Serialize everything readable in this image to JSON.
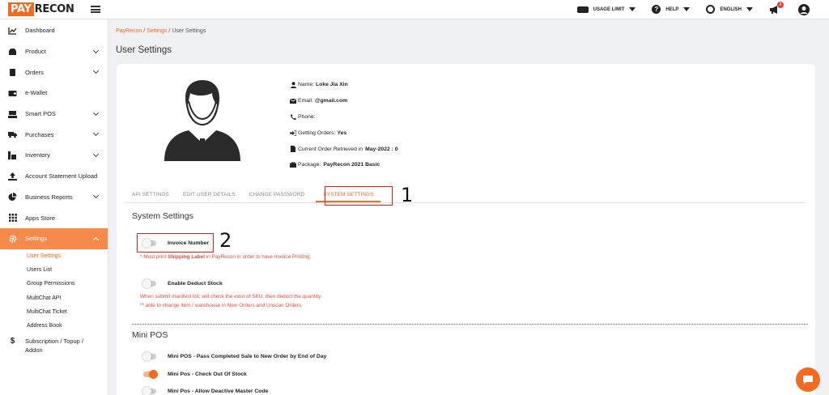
{
  "brand": {
    "pay": "PAY",
    "recon": "RECON",
    "accent": "#f26b21"
  },
  "topbar": {
    "usage_limit": "USAGE LIMIT",
    "help": "HELP",
    "language": "ENGLISH",
    "notification_count": "2"
  },
  "sidebar": {
    "items": [
      {
        "label": "Dashboard",
        "icon": "chart-line-icon"
      },
      {
        "label": "Product",
        "icon": "box-icon"
      },
      {
        "label": "Orders",
        "icon": "clipboard-icon"
      },
      {
        "label": "e-Wallet",
        "icon": "wallet-icon"
      },
      {
        "label": "Smart POS",
        "icon": "pos-icon"
      },
      {
        "label": "Purchases",
        "icon": "truck-icon"
      },
      {
        "label": "Inventory",
        "icon": "boxes-icon"
      },
      {
        "label": "Account Statement Upload",
        "icon": "upload-icon"
      },
      {
        "label": "Business Reports",
        "icon": "pie-chart-icon"
      },
      {
        "label": "Apps Store",
        "icon": "grid-icon"
      },
      {
        "label": "Settings",
        "icon": "gear-icon"
      }
    ],
    "settings_sub": [
      "User Settings",
      "Users List",
      "Group Permissions",
      "MultiChat API",
      "MultiChat Ticket",
      "Address Book"
    ],
    "subscription": {
      "line1": "Subscription / Topup /",
      "line2": "Addon"
    }
  },
  "breadcrumb": {
    "root": "PayRecon",
    "parent": "Settings",
    "current": "User Settings",
    "sep": "/"
  },
  "page_title": "User Settings",
  "profile": {
    "name_label": "Name:",
    "name": "Loke Jia Xin",
    "email_label": "Email:",
    "email": "@gmail.com",
    "phone_label": "Phone:",
    "getting_orders_label": "Getting Orders:",
    "getting_orders": "Yes",
    "current_order_label": "Current Order Retrieved in",
    "current_order": "May-2022 : 0",
    "package_label": "Package:",
    "package": "PayRecon 2021 Basic"
  },
  "tabs": [
    "API SETTINGS",
    "EDIT USER DETAILS",
    "CHANGE PASSWORD",
    "SYSTEM SETTINGS"
  ],
  "annotations": {
    "one": "1",
    "two": "2"
  },
  "system_settings": {
    "title": "System Settings",
    "invoice_number": "Invoice Number",
    "invoice_note_pre": "* Must print ",
    "invoice_note_bold": "Shipping Label",
    "invoice_note_post": " in PayRecon in order to have Invoice Printing.",
    "deduct_stock": "Enable Deduct Stock",
    "deduct_note1": "When submit manifest list, will check the exist of SKU, then deduct the quantity.",
    "deduct_note2": "** able to change item / warehouse in New Orders and Unscan Orders."
  },
  "mini_pos": {
    "title": "Mini POS",
    "items": [
      {
        "label": "Mini POS - Pass Completed Sale to New Order by End of Day",
        "on": false
      },
      {
        "label": "Mini Pos - Check Out Of Stock",
        "on": true
      },
      {
        "label": "Mini Pos - Allow Deactive Master Code",
        "on": false
      }
    ]
  }
}
